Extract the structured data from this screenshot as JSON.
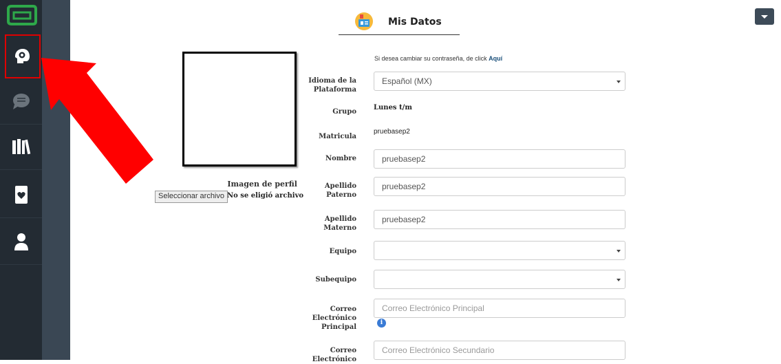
{
  "header": {
    "title": "Mis Datos"
  },
  "password_notice": {
    "text": "Si desea cambiar su contraseña, de click ",
    "link": "Aquí"
  },
  "profile": {
    "image_label": "Imagen de perfil",
    "file_button": "Seleccionar archivo",
    "file_status": "No se eligió archivo"
  },
  "form": {
    "language": {
      "label_line1": "Idioma de la",
      "label_line2": "Plataforma",
      "value": "Español (MX)"
    },
    "group": {
      "label": "Grupo",
      "value": "Lunes t/m"
    },
    "matricula": {
      "label": "Matricula",
      "value": "pruebasep2"
    },
    "nombre": {
      "label": "Nombre",
      "value": "pruebasep2"
    },
    "apellido_paterno": {
      "label_line1": "Apellido",
      "label_line2": "Paterno",
      "value": "pruebasep2"
    },
    "apellido_materno": {
      "label_line1": "Apellido",
      "label_line2": "Materno",
      "value": "pruebasep2"
    },
    "equipo": {
      "label": "Equipo",
      "value": ""
    },
    "subequipo": {
      "label": "Subequipo",
      "value": ""
    },
    "correo_principal": {
      "label_line1": "Correo",
      "label_line2": "Electrónico",
      "label_line3": "Principal",
      "placeholder": "Correo Electrónico Principal"
    },
    "correo_secundario": {
      "label_line1": "Correo",
      "label_line2": "Electrónico",
      "placeholder": "Correo Electrónico Secundario"
    }
  },
  "sidebar": {
    "items": [
      {
        "icon": "settings-gear-head-icon"
      },
      {
        "icon": "chat-bubble-icon"
      },
      {
        "icon": "library-books-icon"
      },
      {
        "icon": "notebook-heart-icon"
      },
      {
        "icon": "user-icon"
      }
    ]
  },
  "colors": {
    "rail": "#232b33",
    "rail_secondary": "#3a4754",
    "highlight": "#e00000",
    "link": "#1a4f7a"
  }
}
